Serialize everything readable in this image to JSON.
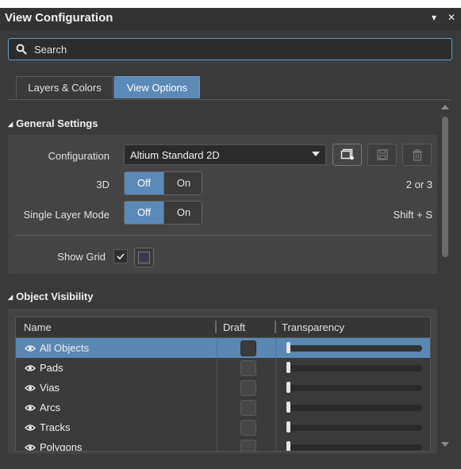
{
  "window": {
    "title": "View Configuration",
    "pin_glyph": "▾",
    "close_glyph": "✕"
  },
  "search": {
    "placeholder": "Search"
  },
  "tabs": [
    {
      "label": "Layers & Colors",
      "active": false
    },
    {
      "label": "View Options",
      "active": true
    }
  ],
  "general_settings": {
    "heading": "General Settings",
    "configuration_label": "Configuration",
    "configuration_value": "Altium Standard 2D",
    "three_d_label": "3D",
    "three_d_off": "Off",
    "three_d_on": "On",
    "three_d_shortcut": "2 or 3",
    "single_layer_label": "Single Layer Mode",
    "single_layer_off": "Off",
    "single_layer_on": "On",
    "single_layer_shortcut": "Shift + S",
    "show_grid_label": "Show Grid",
    "show_grid_checked": true,
    "grid_color": "#3c3a4e"
  },
  "object_visibility": {
    "heading": "Object Visibility",
    "columns": {
      "name": "Name",
      "draft": "Draft",
      "transparency": "Transparency"
    },
    "rows": [
      {
        "name": "All Objects",
        "selected": true,
        "visible": true,
        "draft": false,
        "transparency": 0
      },
      {
        "name": "Pads",
        "selected": false,
        "visible": true,
        "draft": false,
        "transparency": 0
      },
      {
        "name": "Vias",
        "selected": false,
        "visible": true,
        "draft": false,
        "transparency": 0
      },
      {
        "name": "Arcs",
        "selected": false,
        "visible": true,
        "draft": false,
        "transparency": 0
      },
      {
        "name": "Tracks",
        "selected": false,
        "visible": true,
        "draft": false,
        "transparency": 0
      },
      {
        "name": "Polygons",
        "selected": false,
        "visible": true,
        "draft": false,
        "transparency": 0
      }
    ]
  },
  "colors": {
    "accent": "#5b8ab8",
    "focus_border": "#5f9dd6",
    "background": "#3a3a3a"
  }
}
